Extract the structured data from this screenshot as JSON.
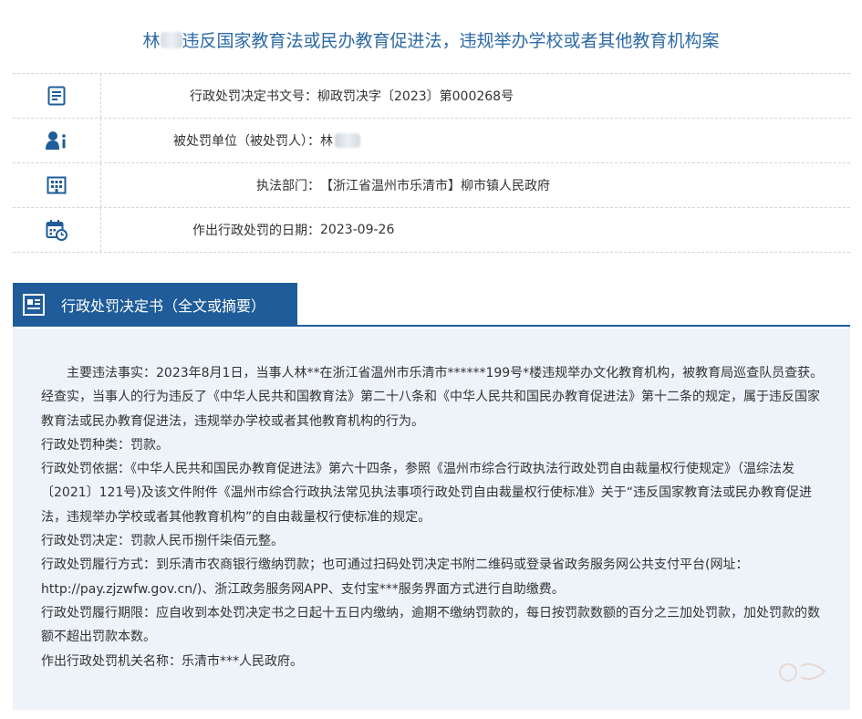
{
  "case": {
    "title_prefix": "林",
    "title_suffix": "违反国家教育法或民办教育促进法，违规举办学校或者其他教育机构案"
  },
  "info_rows": [
    {
      "icon": "document-list-icon",
      "label": "行政处罚决定书文号：",
      "value": "柳政罚决字〔2023〕第000268号"
    },
    {
      "icon": "person-info-icon",
      "label": "被处罚单位（被处罚人）：",
      "value": "林"
    },
    {
      "icon": "building-icon",
      "label": "执法部门：",
      "value": "【浙江省温州市乐清市】柳市镇人民政府"
    },
    {
      "icon": "calendar-clock-icon",
      "label": "作出行政处罚的日期：",
      "value": "2023-09-26"
    }
  ],
  "section": {
    "icon": "document-icon",
    "title": "行政处罚决定书（全文或摘要）"
  },
  "body": {
    "p1": "主要违法事实：2023年8月1日，当事人林**在浙江省温州市乐清市******199号*楼违规举办文化教育机构，被教育局巡查队员查获。经查实，当事人的行为违反了《中华人民共和国教育法》第二十八条和《中华人民共和国民办教育促进法》第十二条的规定，属于违反国家教育法或民办教育促进法，违规举办学校或者其他教育机构的行为。",
    "p2": "行政处罚种类：罚款。",
    "p3": "行政处罚依据：《中华人民共和国民办教育促进法》第六十四条，参照《温州市综合行政执法行政处罚自由裁量权行使规定》（温综法发〔2021〕121号)及该文件附件《温州市综合行政执法常见执法事项行政处罚自由裁量权行使标准》关于“违反国家教育法或民办教育促进法，违规举办学校或者其他教育机构”的自由裁量权行使标准的规定。",
    "p4": "行政处罚决定：罚款人民币捌仟柒佰元整。",
    "p5": "行政处罚履行方式：到乐清市农商银行缴纳罚款；也可通过扫码处罚决定书附二维码或登录省政务服务网公共支付平台(网址：http://pay.zjzwfw.gov.cn/)、浙江政务服务网APP、支付宝***服务界面方式进行自助缴费。",
    "p6": "行政处罚履行期限：应自收到本处罚决定书之日起十五日内缴纳，逾期不缴纳罚款的，每日按罚款数额的百分之三加处罚款，加处罚款的数额不超出罚款本数。",
    "p7": "作出行政处罚机关名称：乐清市***人民政府。"
  },
  "colors": {
    "title": "#2d6aa6",
    "section_bg": "#1f5c99",
    "content_bg": "#eef3f9",
    "icon": "#1f5c99"
  }
}
